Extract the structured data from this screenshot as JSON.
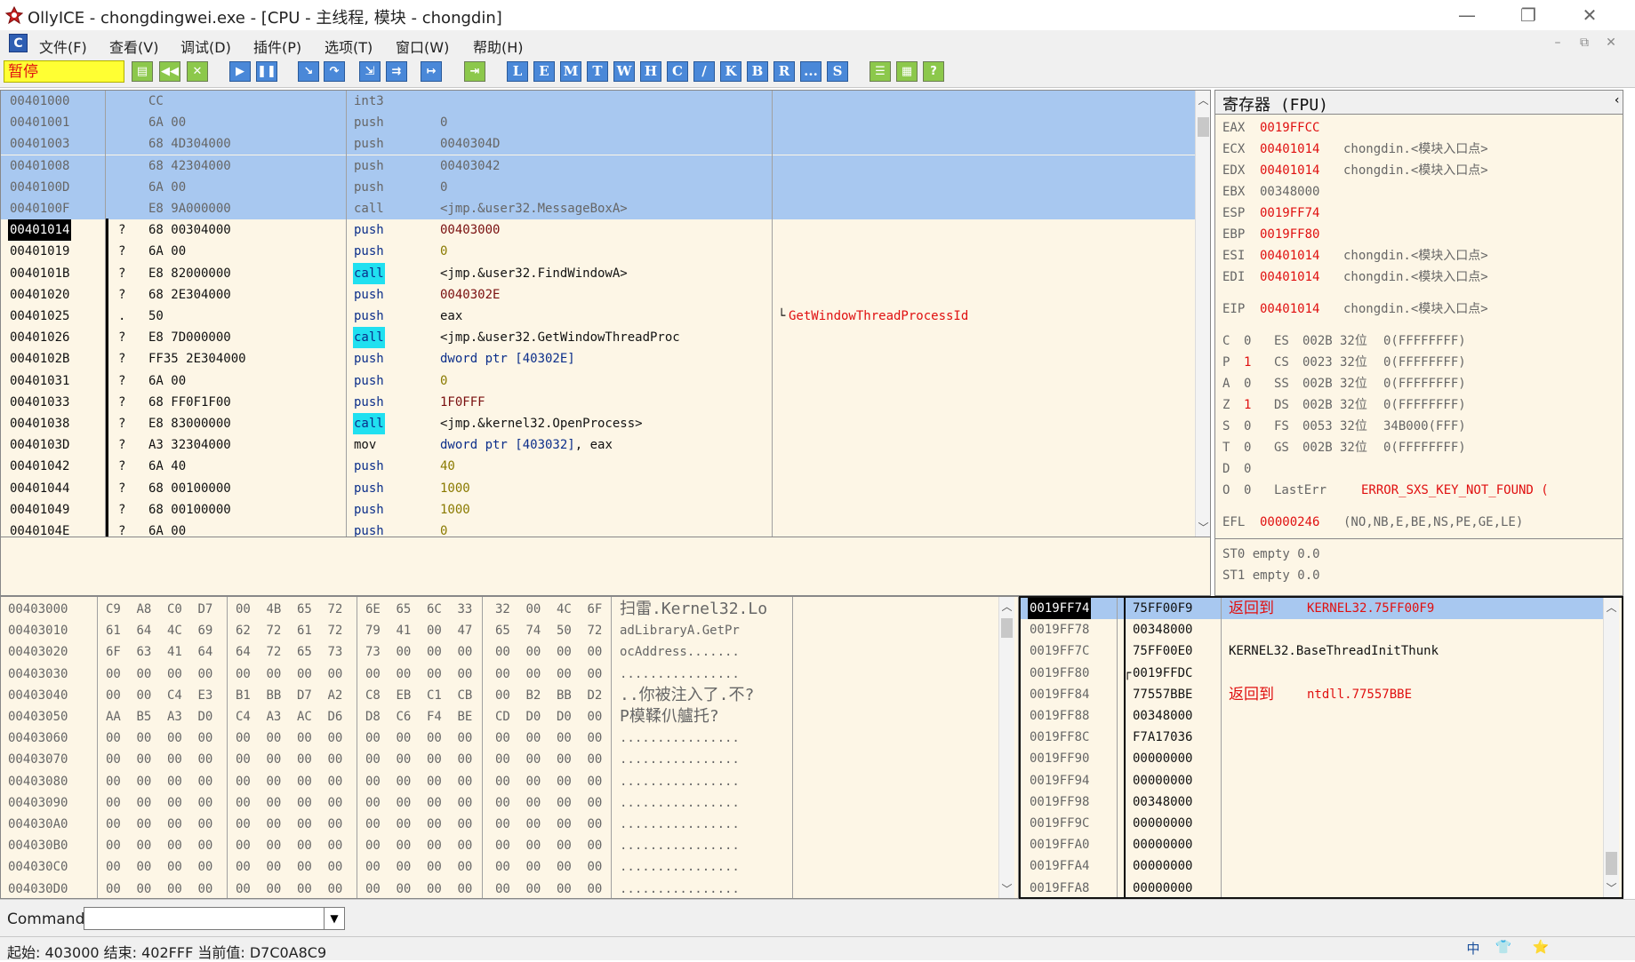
{
  "window": {
    "title": "OllyICE - chongdingwei.exe - [CPU -  主线程, 模块 - chongdin]",
    "min": "—",
    "restore": "❐",
    "close": "✕"
  },
  "menu": {
    "items": [
      "文件(F)",
      "查看(V)",
      "调试(D)",
      "插件(P)",
      "选项(T)",
      "窗口(W)",
      "帮助(H)"
    ],
    "mdi": [
      "–",
      "⧉",
      "✕"
    ]
  },
  "toolbar": {
    "state": "暂停",
    "letters": [
      "L",
      "E",
      "M",
      "T",
      "W",
      "H",
      "C",
      "/",
      "K",
      "B",
      "R",
      "...",
      "S"
    ]
  },
  "disasm": {
    "rows": [
      {
        "addr": "00401000",
        "mark": "",
        "hex": "CC",
        "op": "int3",
        "arg": "",
        "sel": true
      },
      {
        "addr": "00401001",
        "mark": "",
        "hex": "6A 00",
        "op": "push",
        "arg": "0",
        "sel": true
      },
      {
        "addr": "00401003",
        "mark": "",
        "hex": "68 4D304000",
        "op": "push",
        "arg": "0040304D",
        "sel": true
      },
      {
        "addr": "00401008",
        "mark": "",
        "hex": "68 42304000",
        "op": "push",
        "arg": "00403042",
        "sel": true
      },
      {
        "addr": "0040100D",
        "mark": "",
        "hex": "6A 00",
        "op": "push",
        "arg": "0",
        "sel": true
      },
      {
        "addr": "0040100F",
        "mark": "",
        "hex": "E8 9A000000",
        "op": "call",
        "arg": "<jmp.&user32.MessageBoxA>",
        "sel": true
      },
      {
        "addr": "00401014",
        "mark": "?",
        "hex": "68 00304000",
        "op": "push",
        "arg": "00403000",
        "eip": true
      },
      {
        "addr": "00401019",
        "mark": "?",
        "hex": "6A 00",
        "op": "push",
        "arg": "0"
      },
      {
        "addr": "0040101B",
        "mark": "?",
        "hex": "E8 82000000",
        "op": "call",
        "arg": "<jmp.&user32.FindWindowA>"
      },
      {
        "addr": "00401020",
        "mark": "?",
        "hex": "68 2E304000",
        "op": "push",
        "arg": "0040302E"
      },
      {
        "addr": "00401025",
        "mark": ".",
        "hex": "50",
        "op": "push",
        "arg": "eax",
        "comment": "GetWindowThreadProcessId"
      },
      {
        "addr": "00401026",
        "mark": "?",
        "hex": "E8 7D000000",
        "op": "call",
        "arg": "<jmp.&user32.GetWindowThreadProc"
      },
      {
        "addr": "0040102B",
        "mark": "?",
        "hex": "FF35 2E304000",
        "op": "push",
        "arg": "dword ptr [40302E]"
      },
      {
        "addr": "00401031",
        "mark": "?",
        "hex": "6A 00",
        "op": "push",
        "arg": "0"
      },
      {
        "addr": "00401033",
        "mark": "?",
        "hex": "68 FF0F1F00",
        "op": "push",
        "arg": "1F0FFF"
      },
      {
        "addr": "00401038",
        "mark": "?",
        "hex": "E8 83000000",
        "op": "call",
        "arg": "<jmp.&kernel32.OpenProcess>"
      },
      {
        "addr": "0040103D",
        "mark": "?",
        "hex": "A3 32304000",
        "op": "mov",
        "arg": "dword ptr [403032]",
        "arg2": ", eax"
      },
      {
        "addr": "00401042",
        "mark": "?",
        "hex": "6A 40",
        "op": "push",
        "arg": "40"
      },
      {
        "addr": "00401044",
        "mark": "?",
        "hex": "68 00100000",
        "op": "push",
        "arg": "1000"
      },
      {
        "addr": "00401049",
        "mark": "?",
        "hex": "68 00100000",
        "op": "push",
        "arg": "1000"
      },
      {
        "addr": "0040104E",
        "mark": "?",
        "hex": "6A 00",
        "op": "push",
        "arg": "0"
      }
    ]
  },
  "registers": {
    "header": "寄存器 (FPU)",
    "gp": [
      {
        "name": "EAX",
        "val": "0019FFCC",
        "desc": ""
      },
      {
        "name": "ECX",
        "val": "00401014",
        "desc": "chongdin.<模块入口点>"
      },
      {
        "name": "EDX",
        "val": "00401014",
        "desc": "chongdin.<模块入口点>"
      },
      {
        "name": "EBX",
        "val": "00348000",
        "desc": "",
        "plain": true
      },
      {
        "name": "ESP",
        "val": "0019FF74",
        "desc": ""
      },
      {
        "name": "EBP",
        "val": "0019FF80",
        "desc": ""
      },
      {
        "name": "ESI",
        "val": "00401014",
        "desc": "chongdin.<模块入口点>"
      },
      {
        "name": "EDI",
        "val": "00401014",
        "desc": "chongdin.<模块入口点>"
      }
    ],
    "eip": {
      "name": "EIP",
      "val": "00401014",
      "desc": "chongdin.<模块入口点>"
    },
    "flags": [
      {
        "f": "C",
        "v": "0",
        "seg": "ES",
        "sv": "002B",
        "bits": "32位",
        "rest": "0(FFFFFFFF)"
      },
      {
        "f": "P",
        "v": "1",
        "seg": "CS",
        "sv": "0023",
        "bits": "32位",
        "rest": "0(FFFFFFFF)",
        "hot": true
      },
      {
        "f": "A",
        "v": "0",
        "seg": "SS",
        "sv": "002B",
        "bits": "32位",
        "rest": "0(FFFFFFFF)"
      },
      {
        "f": "Z",
        "v": "1",
        "seg": "DS",
        "sv": "002B",
        "bits": "32位",
        "rest": "0(FFFFFFFF)",
        "hot": true
      },
      {
        "f": "S",
        "v": "0",
        "seg": "FS",
        "sv": "0053",
        "bits": "32位",
        "rest": "34B000(FFF)"
      },
      {
        "f": "T",
        "v": "0",
        "seg": "GS",
        "sv": "002B",
        "bits": "32位",
        "rest": "0(FFFFFFFF)"
      },
      {
        "f": "D",
        "v": "0",
        "seg": "",
        "sv": "",
        "bits": "",
        "rest": ""
      },
      {
        "f": "O",
        "v": "0",
        "seg": "LastErr",
        "sv": "",
        "bits": "",
        "rest": "ERROR_SXS_KEY_NOT_FOUND (",
        "err": true
      }
    ],
    "efl": {
      "name": "EFL",
      "val": "00000246",
      "desc": "(NO,NB,E,BE,NS,PE,GE,LE)"
    },
    "st": [
      "ST0 empty 0.0",
      "ST1 empty 0.0"
    ]
  },
  "dump": {
    "rows": [
      {
        "addr": "00403000",
        "bytes": [
          "C9",
          "A8",
          "C0",
          "D7",
          "00",
          "4B",
          "65",
          "72",
          "6E",
          "65",
          "6C",
          "33",
          "32",
          "00",
          "4C",
          "6F"
        ],
        "ascii": "扫雷.Kernel32.Lo"
      },
      {
        "addr": "00403010",
        "bytes": [
          "61",
          "64",
          "4C",
          "69",
          "62",
          "72",
          "61",
          "72",
          "79",
          "41",
          "00",
          "47",
          "65",
          "74",
          "50",
          "72"
        ],
        "ascii": "adLibraryA.GetPr"
      },
      {
        "addr": "00403020",
        "bytes": [
          "6F",
          "63",
          "41",
          "64",
          "64",
          "72",
          "65",
          "73",
          "73",
          "00",
          "00",
          "00",
          "00",
          "00",
          "00",
          "00"
        ],
        "ascii": "ocAddress......."
      },
      {
        "addr": "00403030",
        "bytes": [
          "00",
          "00",
          "00",
          "00",
          "00",
          "00",
          "00",
          "00",
          "00",
          "00",
          "00",
          "00",
          "00",
          "00",
          "00",
          "00"
        ],
        "ascii": "................"
      },
      {
        "addr": "00403040",
        "bytes": [
          "00",
          "00",
          "C4",
          "E3",
          "B1",
          "BB",
          "D7",
          "A2",
          "C8",
          "EB",
          "C1",
          "CB",
          "00",
          "B2",
          "BB",
          "D2"
        ],
        "ascii": "..你被注入了.不?"
      },
      {
        "addr": "00403050",
        "bytes": [
          "AA",
          "B5",
          "A3",
          "D0",
          "C4",
          "A3",
          "AC",
          "D6",
          "D8",
          "C6",
          "F4",
          "BE",
          "CD",
          "D0",
          "D0",
          "00"
        ],
        "ascii": "P模鞣仈艫托?"
      },
      {
        "addr": "00403060",
        "bytes": [
          "00",
          "00",
          "00",
          "00",
          "00",
          "00",
          "00",
          "00",
          "00",
          "00",
          "00",
          "00",
          "00",
          "00",
          "00",
          "00"
        ],
        "ascii": "................"
      },
      {
        "addr": "00403070",
        "bytes": [
          "00",
          "00",
          "00",
          "00",
          "00",
          "00",
          "00",
          "00",
          "00",
          "00",
          "00",
          "00",
          "00",
          "00",
          "00",
          "00"
        ],
        "ascii": "................"
      },
      {
        "addr": "00403080",
        "bytes": [
          "00",
          "00",
          "00",
          "00",
          "00",
          "00",
          "00",
          "00",
          "00",
          "00",
          "00",
          "00",
          "00",
          "00",
          "00",
          "00"
        ],
        "ascii": "................"
      },
      {
        "addr": "00403090",
        "bytes": [
          "00",
          "00",
          "00",
          "00",
          "00",
          "00",
          "00",
          "00",
          "00",
          "00",
          "00",
          "00",
          "00",
          "00",
          "00",
          "00"
        ],
        "ascii": "................"
      },
      {
        "addr": "004030A0",
        "bytes": [
          "00",
          "00",
          "00",
          "00",
          "00",
          "00",
          "00",
          "00",
          "00",
          "00",
          "00",
          "00",
          "00",
          "00",
          "00",
          "00"
        ],
        "ascii": "................"
      },
      {
        "addr": "004030B0",
        "bytes": [
          "00",
          "00",
          "00",
          "00",
          "00",
          "00",
          "00",
          "00",
          "00",
          "00",
          "00",
          "00",
          "00",
          "00",
          "00",
          "00"
        ],
        "ascii": "................"
      },
      {
        "addr": "004030C0",
        "bytes": [
          "00",
          "00",
          "00",
          "00",
          "00",
          "00",
          "00",
          "00",
          "00",
          "00",
          "00",
          "00",
          "00",
          "00",
          "00",
          "00"
        ],
        "ascii": "................"
      },
      {
        "addr": "004030D0",
        "bytes": [
          "00",
          "00",
          "00",
          "00",
          "00",
          "00",
          "00",
          "00",
          "00",
          "00",
          "00",
          "00",
          "00",
          "00",
          "00",
          "00"
        ],
        "ascii": "................"
      }
    ]
  },
  "stack": {
    "rows": [
      {
        "addr": "0019FF74",
        "val": "75FF00F9",
        "note": "返回到 KERNEL32.75FF00F9",
        "top": true,
        "ret": true
      },
      {
        "addr": "0019FF78",
        "val": "00348000",
        "note": ""
      },
      {
        "addr": "0019FF7C",
        "val": "75FF00E0",
        "note": "KERNEL32.BaseThreadInitThunk"
      },
      {
        "addr": "0019FF80",
        "val": "0019FFDC",
        "note": "",
        "frame": true
      },
      {
        "addr": "0019FF84",
        "val": "77557BBE",
        "note": "返回到 ntdll.77557BBE",
        "ret": true
      },
      {
        "addr": "0019FF88",
        "val": "00348000",
        "note": ""
      },
      {
        "addr": "0019FF8C",
        "val": "F7A17036",
        "note": ""
      },
      {
        "addr": "0019FF90",
        "val": "00000000",
        "note": ""
      },
      {
        "addr": "0019FF94",
        "val": "00000000",
        "note": ""
      },
      {
        "addr": "0019FF98",
        "val": "00348000",
        "note": ""
      },
      {
        "addr": "0019FF9C",
        "val": "00000000",
        "note": ""
      },
      {
        "addr": "0019FFA0",
        "val": "00000000",
        "note": ""
      },
      {
        "addr": "0019FFA4",
        "val": "00000000",
        "note": ""
      },
      {
        "addr": "0019FFA8",
        "val": "00000000",
        "note": ""
      }
    ]
  },
  "command": {
    "label": "Command",
    "value": ""
  },
  "status": {
    "text": "起始: 403000  结束: 402FFF  当前值: D7C0A8C9",
    "ime": [
      "中",
      "👕",
      "⭐"
    ]
  }
}
